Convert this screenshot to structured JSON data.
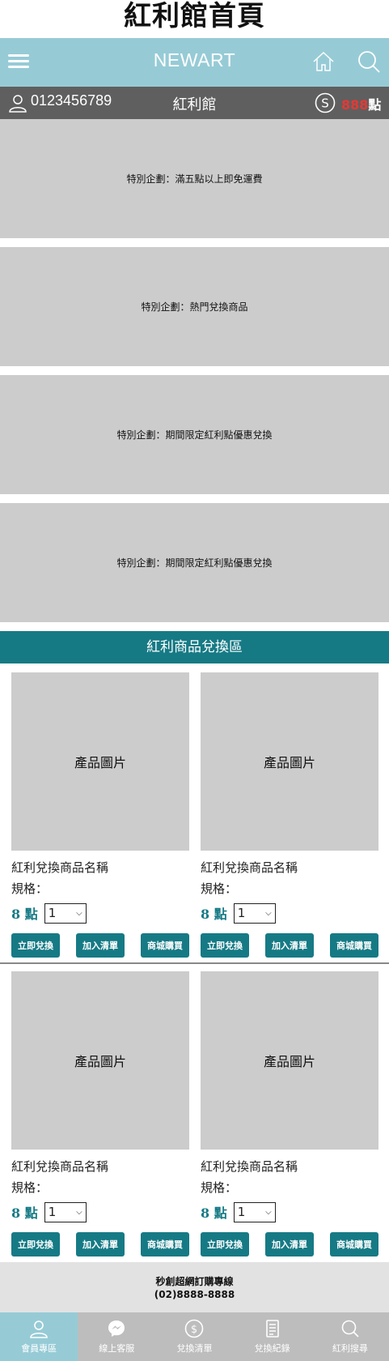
{
  "page": {
    "title": "紅利館首頁"
  },
  "header": {
    "brand": "NEWART"
  },
  "userbar": {
    "member_id": "0123456789",
    "section": "紅利館",
    "points_value": "888",
    "points_unit": "點"
  },
  "banners": [
    "特別企劃：滿五點以上即免運費",
    "特別企劃：熱門兌換商品",
    "特別企劃：期間限定紅利點優惠兌換",
    "特別企劃：期間限定紅利點優惠兌換"
  ],
  "zone": {
    "title": "紅利商品兌換區"
  },
  "products": [
    {
      "image_label": "產品圖片",
      "name": "紅利兌換商品名稱",
      "spec": "規格：",
      "price": "8 點",
      "qty": "1"
    },
    {
      "image_label": "產品圖片",
      "name": "紅利兌換商品名稱",
      "spec": "規格：",
      "price": "8 點",
      "qty": "1"
    },
    {
      "image_label": "產品圖片",
      "name": "紅利兌換商品名稱",
      "spec": "規格：",
      "price": "8 點",
      "qty": "1"
    },
    {
      "image_label": "產品圖片",
      "name": "紅利兌換商品名稱",
      "spec": "規格：",
      "price": "8 點",
      "qty": "1"
    }
  ],
  "product_buttons": {
    "redeem": "立即兌換",
    "add_list": "加入清單",
    "buy": "商城購買"
  },
  "footer": {
    "hotline_label": "秒創超網訂購專線",
    "hotline_number": "(02)8888-8888"
  },
  "tabbar": [
    {
      "label": "會員專區",
      "icon": "user-icon"
    },
    {
      "label": "線上客服",
      "icon": "messenger-icon"
    },
    {
      "label": "兌換清單",
      "icon": "coin-icon"
    },
    {
      "label": "兌換紀錄",
      "icon": "receipt-icon"
    },
    {
      "label": "紅利搜尋",
      "icon": "search-icon"
    }
  ],
  "colors": {
    "topbar": "#96cbd6",
    "accent": "#167a85",
    "userbar": "#5f5f5f",
    "points": "#e53935",
    "placeholder": "#cccccc"
  }
}
